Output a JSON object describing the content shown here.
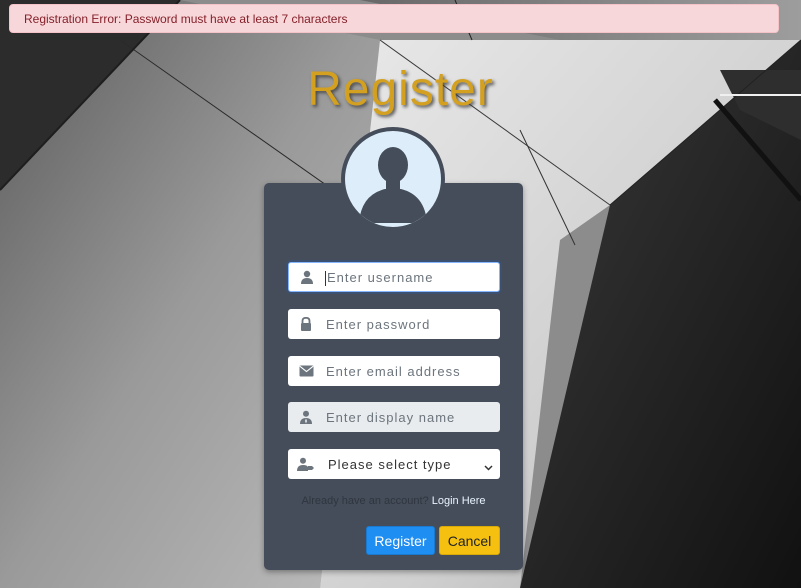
{
  "alert": {
    "message": "Registration Error: Password must have at least 7 characters"
  },
  "page": {
    "title": "Register"
  },
  "form": {
    "username": {
      "placeholder": "Enter username",
      "icon": "user-icon"
    },
    "password": {
      "placeholder": "Enter password",
      "icon": "lock-icon"
    },
    "email": {
      "placeholder": "Enter email address",
      "icon": "envelope-icon"
    },
    "display_name": {
      "placeholder": "Enter display name",
      "icon": "user-tie-icon"
    },
    "type_select": {
      "selected": "Please select type",
      "icon": "user-tag-icon"
    }
  },
  "login_prompt": {
    "text": "Already have an account?",
    "link": "Login Here"
  },
  "buttons": {
    "register": "Register",
    "cancel": "Cancel"
  },
  "colors": {
    "title": "#d4a020",
    "card": "#454d5a",
    "alert_bg": "#f8d7da",
    "alert_text": "#842029",
    "register_btn": "#1e8ef2",
    "cancel_btn": "#f6c010",
    "avatar_bg": "#ddeefa"
  }
}
